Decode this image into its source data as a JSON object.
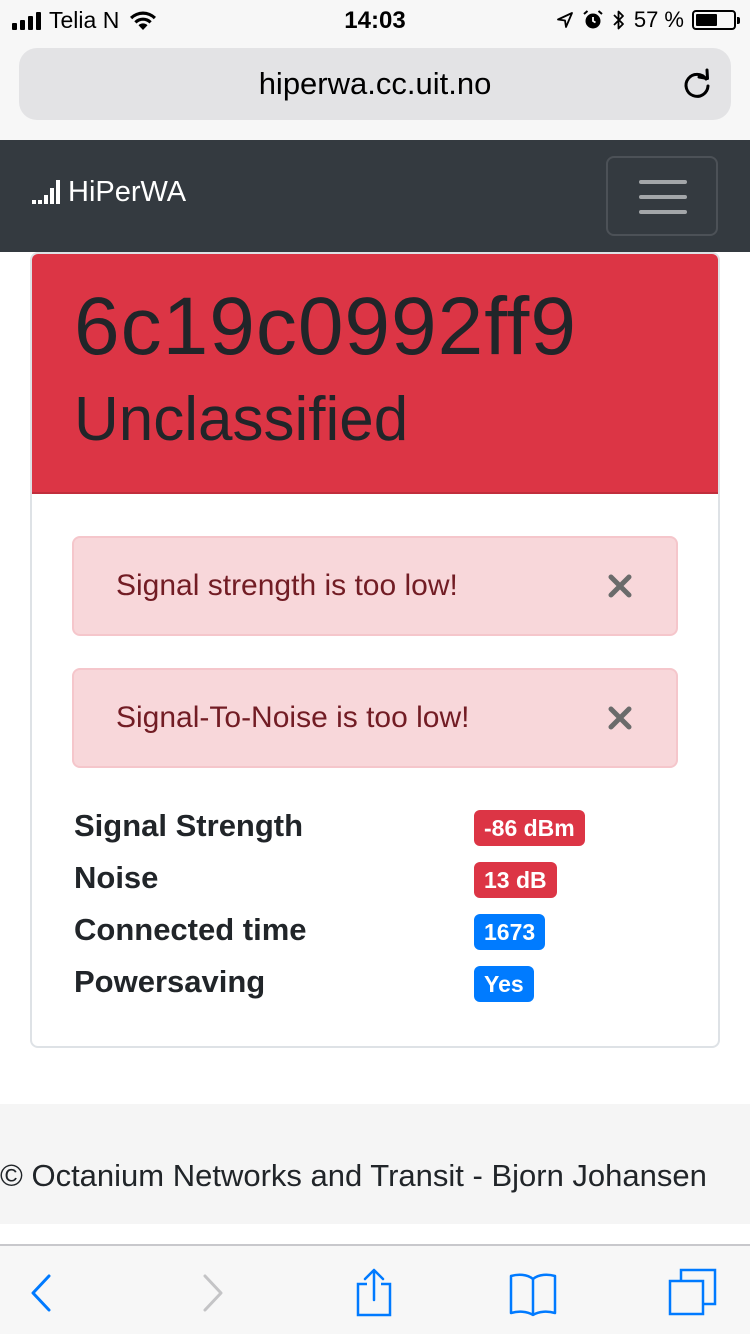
{
  "status_bar": {
    "carrier": "Telia N",
    "time": "14:03",
    "battery_percent": "57 %",
    "battery_level": 0.57
  },
  "browser": {
    "url": "hiperwa.cc.uit.no"
  },
  "navbar": {
    "brand": "HiPerWA"
  },
  "card": {
    "device_id": "6c19c0992ff9",
    "classification": "Unclassified",
    "header_color": "#dc3545"
  },
  "alerts": [
    {
      "text": "Signal strength is too low!",
      "close_glyph": "✕"
    },
    {
      "text": "Signal-To-Noise is too low!",
      "close_glyph": "✕"
    }
  ],
  "info": [
    {
      "label": "Signal Strength",
      "value": "-86 dBm",
      "status": "danger"
    },
    {
      "label": "Noise",
      "value": "13 dB",
      "status": "danger"
    },
    {
      "label": "Connected time",
      "value": "1673",
      "status": "primary"
    },
    {
      "label": "Powersaving",
      "value": "Yes",
      "status": "primary"
    }
  ],
  "footer": {
    "text": "© Octanium Networks and Transit - Bjorn Johansen"
  },
  "colors": {
    "danger": "#dc3545",
    "primary": "#007bff",
    "navbar": "#343a40",
    "alert_bg": "#f8d7da",
    "alert_text": "#721c24",
    "ios_blue": "#007aff"
  }
}
